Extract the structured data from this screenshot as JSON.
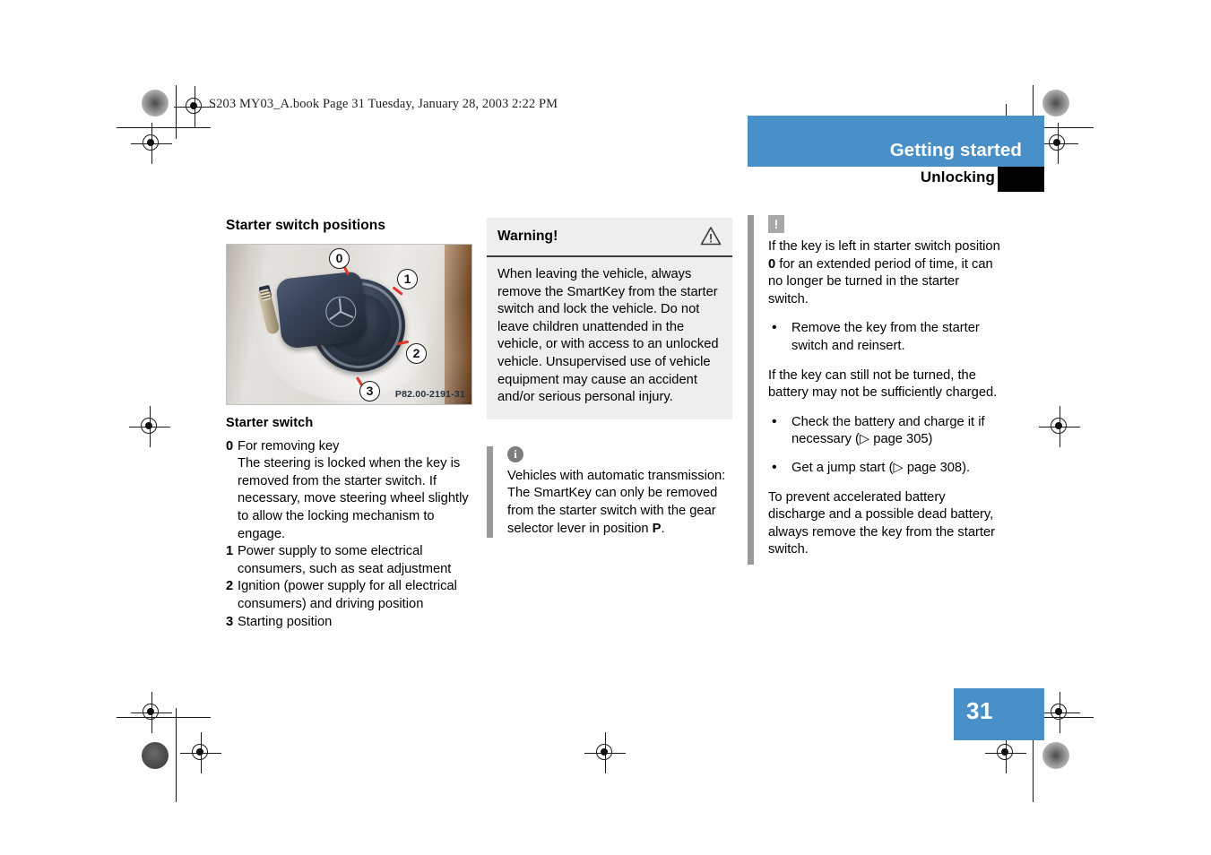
{
  "file_header": "S203 MY03_A.book  Page 31  Tuesday, January 28, 2003  2:22 PM",
  "running_head": {
    "chapter": "Getting started",
    "section": "Unlocking"
  },
  "page_number": "31",
  "left_column": {
    "section_title": "Starter switch positions",
    "figure": {
      "caption": "Starter switch",
      "image_code": "P82.00-2191-31",
      "callouts": [
        "0",
        "1",
        "2",
        "3"
      ]
    },
    "legend": [
      {
        "num": "0",
        "line1": "For removing key",
        "line2": "The steering is locked when the key is removed from the starter switch. If necessary, move steering wheel slightly to allow the locking mechanism to engage."
      },
      {
        "num": "1",
        "line1": "Power supply to some electrical consumers, such as seat adjustment",
        "line2": ""
      },
      {
        "num": "2",
        "line1": "Ignition (power supply for all electrical consumers) and driving position",
        "line2": ""
      },
      {
        "num": "3",
        "line1": "Starting position",
        "line2": ""
      }
    ]
  },
  "middle_column": {
    "warning": {
      "title": "Warning!",
      "icon": "warning-triangle-icon",
      "body": "When leaving the vehicle, always remove the SmartKey from the starter switch and lock the vehicle. Do not leave children unattended in the vehicle, or with access to an unlocked vehicle. Unsupervised use of vehicle equipment may cause an accident and/or serious personal injury."
    },
    "note": {
      "icon": "info-circle-icon",
      "text_part1": "Vehicles with automatic transmission: The SmartKey can only be removed from the starter switch with the gear selector lever in position ",
      "text_bold": "P",
      "text_part2": "."
    }
  },
  "right_column": {
    "icon": "exclamation-box-icon",
    "para1_part1": "If the key is left in starter switch position ",
    "para1_bold": "0",
    "para1_part2": " for an extended period of time, it can no longer be turned in the starter switch.",
    "bullets1": [
      "Remove the key from the starter switch and reinsert."
    ],
    "para2": "If the key can still not be turned, the battery may not be sufficiently charged.",
    "bullets2": [
      "Check the battery and charge it if necessary (▷ page 305)",
      "Get a jump start (▷ page 308)."
    ],
    "para3": "To prevent accelerated battery discharge and a possible dead battery, always remove the key from the starter switch."
  },
  "colors": {
    "accent_blue": "#4a90c8",
    "note_bar_gray": "#9a9a9a",
    "warn_bg": "#eeeeee",
    "tab_black": "#000000"
  }
}
